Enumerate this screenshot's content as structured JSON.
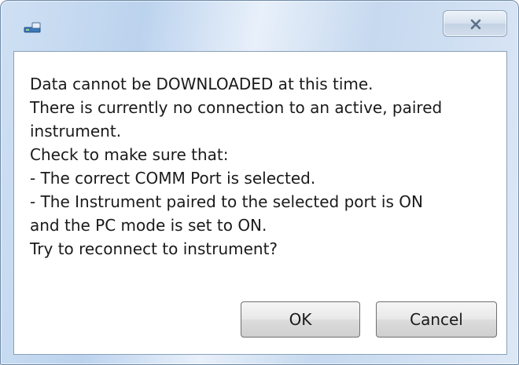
{
  "window": {
    "title": "",
    "icons": {
      "app": "app-icon",
      "close": "close-icon"
    }
  },
  "message": {
    "lines": [
      "Data cannot be DOWNLOADED at this time.",
      "There is currently no connection to an active, paired",
      "instrument.",
      "Check to make sure that:",
      "- The correct COMM Port is selected.",
      "- The Instrument paired to the selected port is ON",
      "and the PC mode is set to ON.",
      "Try to reconnect to instrument?"
    ]
  },
  "buttons": {
    "ok_label": "OK",
    "cancel_label": "Cancel"
  },
  "colors": {
    "title_bar": "#c6d9ef",
    "client_bg": "#ffffff",
    "text": "#1a1a1a"
  }
}
